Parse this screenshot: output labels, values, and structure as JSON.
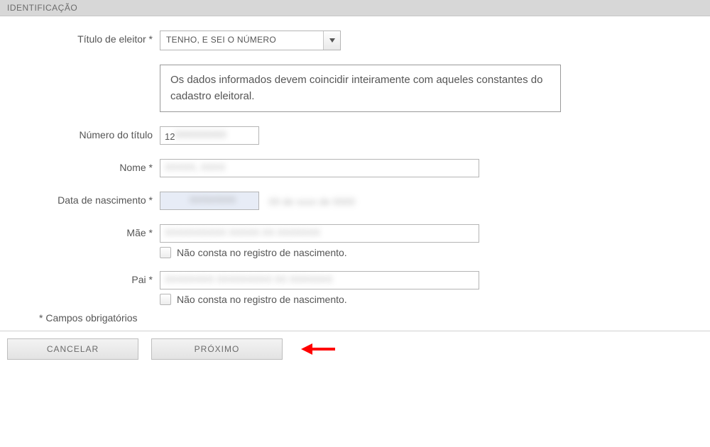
{
  "section": {
    "title": "IDENTIFICAÇÃO"
  },
  "fields": {
    "titulo_eleitor": {
      "label": "Título de eleitor *",
      "value": "TENHO, E SEI O NÚMERO"
    },
    "notice": "Os dados informados devem coincidir inteiramente com aqueles constantes do cadastro eleitoral.",
    "numero_titulo": {
      "label": "Número do título",
      "value": "12"
    },
    "nome": {
      "label": "Nome *",
      "value": ""
    },
    "data_nascimento": {
      "label": "Data de nascimento *",
      "value": "",
      "aux": ""
    },
    "mae": {
      "label": "Mãe *",
      "value": "",
      "checkbox_label": "Não consta no registro de nascimento."
    },
    "pai": {
      "label": "Pai *",
      "value": "",
      "checkbox_label": "Não consta no registro de nascimento."
    }
  },
  "required_note": "* Campos obrigatórios",
  "buttons": {
    "cancel": "CANCELAR",
    "next": "PRÓXIMO"
  }
}
